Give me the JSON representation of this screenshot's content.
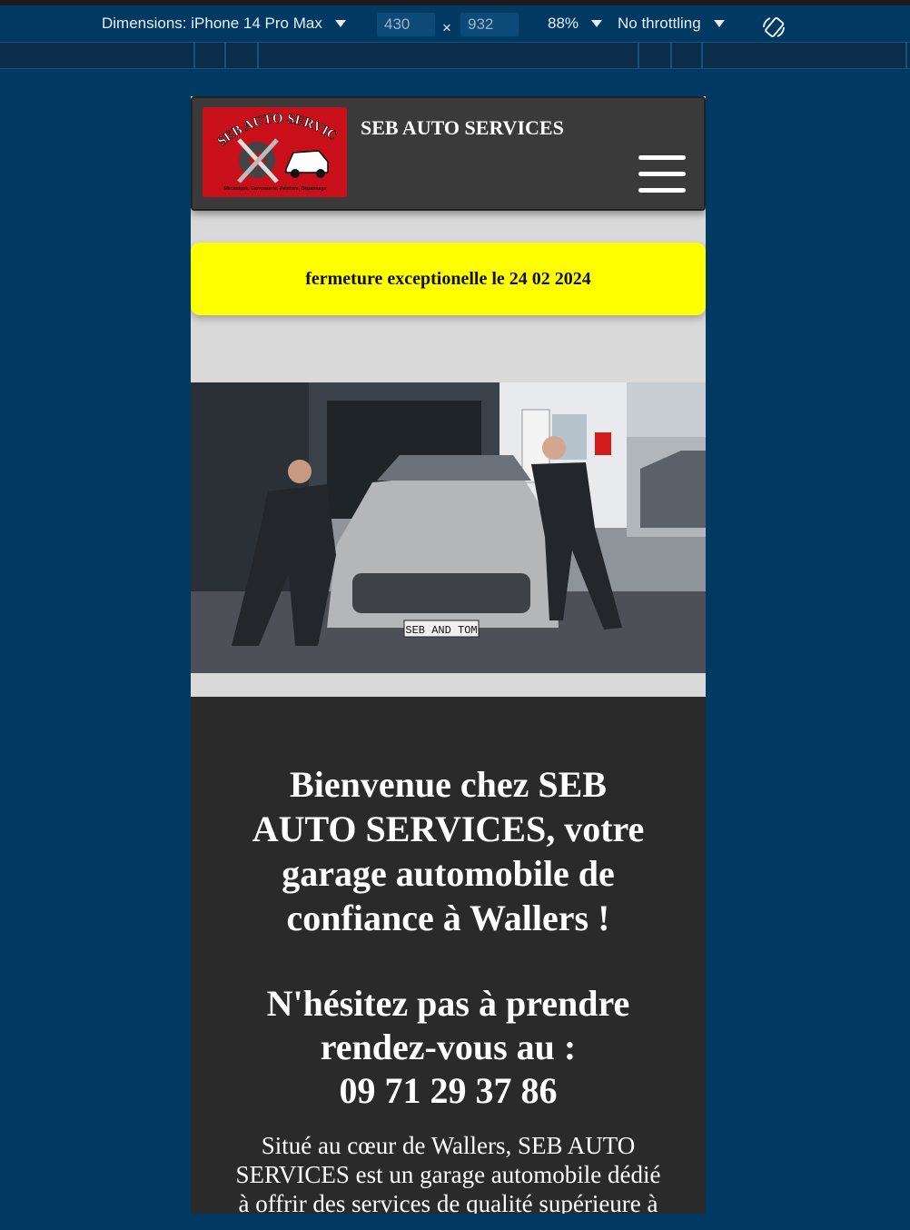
{
  "devtools": {
    "dimensions_label": "Dimensions: iPhone 14 Pro Max",
    "width_value": "430",
    "height_value": "932",
    "times_sign": "×",
    "zoom": "88%",
    "throttling": "No throttling"
  },
  "site": {
    "title": "SEB AUTO SERVICES",
    "logo": {
      "arc_text": "SEB AUTO SERVICES",
      "tagline": "Mécanique, Carrosserie, Peinture, Dépannage",
      "colors": {
        "background": "#c9101a",
        "gear": "#444444"
      }
    },
    "menu_icon": "hamburger-menu-icon",
    "notice": "fermeture exceptionelle le 24 02 2024",
    "hero_plate": "SEB AND TOM",
    "welcome_lines": [
      "Bienvenue chez SEB",
      "AUTO SERVICES, votre",
      "garage automobile de",
      "confiance à Wallers !"
    ],
    "cta_lines": [
      "N'hésitez pas à prendre",
      "rendez-vous au :",
      "09 71 29 37 86"
    ],
    "intro_lines": [
      "Situé au cœur de Wallers, SEB AUTO",
      "SERVICES est un garage automobile dédié",
      "à offrir des services de qualité supérieure à"
    ]
  },
  "colors": {
    "devtools_bg": "#003a63",
    "header_bg": "#3a3a3a",
    "notice_bg": "#ffff00",
    "section_bg": "#2a2a2a",
    "page_bg": "#d9d9d9"
  }
}
